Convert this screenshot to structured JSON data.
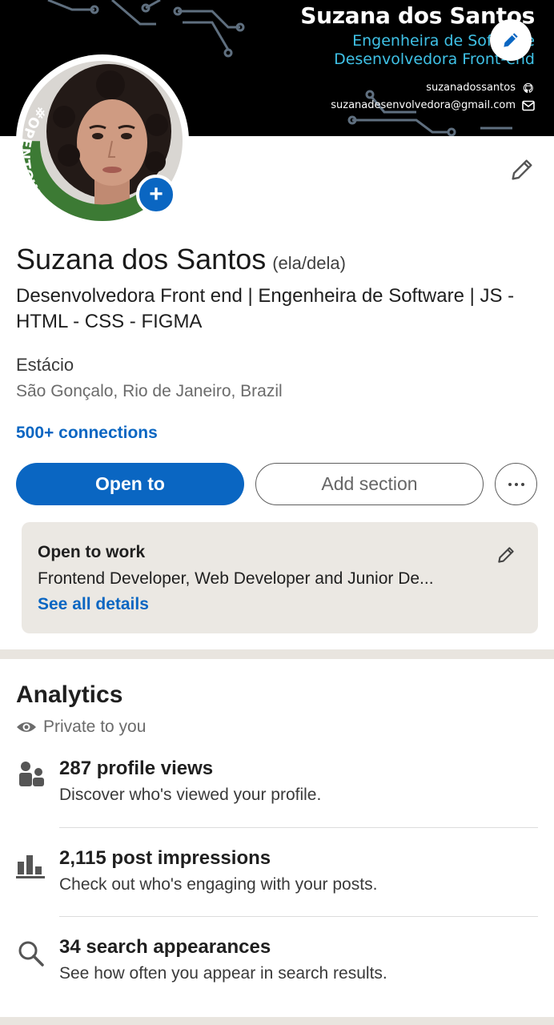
{
  "banner": {
    "name": "Suzana dos Santos",
    "subtitle_1": "Engenheira de Software",
    "subtitle_2": "Desenvolvedora Front-end",
    "github_handle": "suzanadossantos",
    "email": "suzanadesenvolvedora@gmail.com"
  },
  "profile": {
    "avatar_frame_text": "#OPENTOWORK",
    "name": "Suzana dos Santos",
    "pronouns": "(ela/dela)",
    "headline": "Desenvolvedora Front end | Engenheira de Software | JS - HTML - CSS - FIGMA",
    "school": "Estácio",
    "location": "São Gonçalo, Rio de Janeiro, Brazil",
    "connections": "500+ connections"
  },
  "actions": {
    "open_to": "Open to",
    "add_section": "Add section"
  },
  "open_to_work": {
    "title": "Open to work",
    "roles": "Frontend Developer, Web Developer and Junior De...",
    "link": "See all details"
  },
  "analytics": {
    "title": "Analytics",
    "visibility": "Private to you",
    "items": [
      {
        "icon": "people-icon",
        "title": "287 profile views",
        "desc": "Discover who's viewed your profile."
      },
      {
        "icon": "bar-chart-icon",
        "title": "2,115 post impressions",
        "desc": "Check out who's engaging with your posts."
      },
      {
        "icon": "search-icon",
        "title": "34 search appearances",
        "desc": "See how often you appear in search results."
      }
    ]
  },
  "colors": {
    "primary": "#0a66c2",
    "banner_bg": "#000000",
    "banner_accent": "#3fc1e6",
    "open_to_work_green": "#2e7d32",
    "card_bg": "#ebe8e3"
  }
}
